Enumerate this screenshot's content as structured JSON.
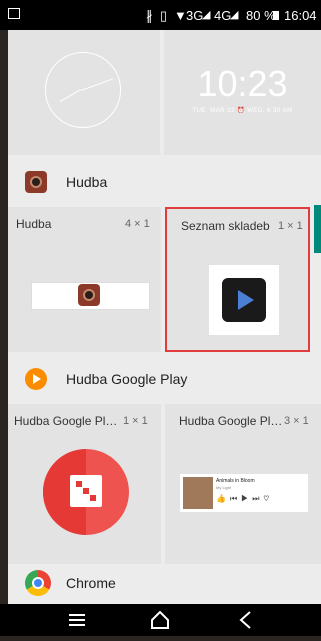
{
  "status_bar": {
    "network_3g": "3G",
    "network_4g": "4G",
    "battery_percent": "80 %",
    "time": "16:04"
  },
  "clock_widget": {
    "time": "10:23",
    "date": "TUE, MAR 22 ⏰ WED, 6:30 AM"
  },
  "sections": [
    {
      "app_name": "Hudba",
      "widgets": [
        {
          "title": "Hudba",
          "size": "4 × 1"
        },
        {
          "title": "Seznam skladeb",
          "size": "1 × 1"
        }
      ]
    },
    {
      "app_name": "Hudba Google Play",
      "widgets": [
        {
          "title": "Hudba Google Pl…",
          "size": "1 × 1"
        },
        {
          "title": "Hudba Google Pl…",
          "size": "3 × 1"
        }
      ],
      "preview": {
        "song": "Animals in Bloom",
        "artist": "My Light"
      }
    },
    {
      "app_name": "Chrome"
    }
  ],
  "colors": {
    "selection": "#e03c3c",
    "sheet_bg": "#ececec",
    "teal_handle": "#00897b"
  }
}
